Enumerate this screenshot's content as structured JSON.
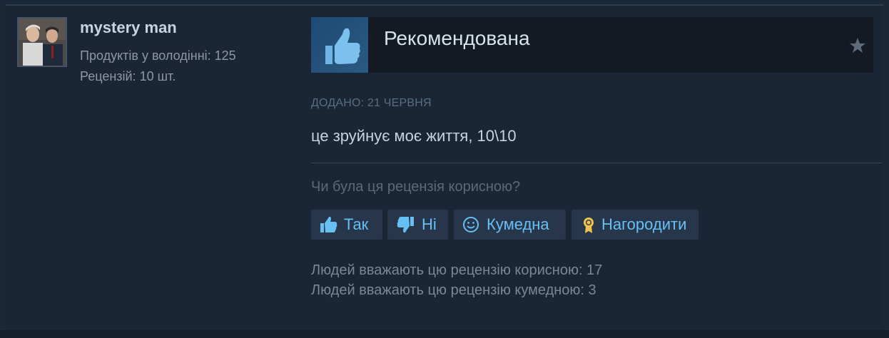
{
  "author": {
    "name": "mystery man",
    "products_owned": "Продуктів у володінні: 125",
    "reviews": "Рецензій: 10 шт."
  },
  "review": {
    "verdict": "Рекомендована",
    "posted": "ДОДАНО: 21 ЧЕРВНЯ",
    "text": "це зруйнує моє життя, 10\\10",
    "helpful_question": "Чи була ця рецензія корисною?"
  },
  "buttons": {
    "yes": "Так",
    "no": "Ні",
    "funny": "Кумедна",
    "award": "Нагородити"
  },
  "stats": {
    "helpful": "Людей вважають цю рецензію корисною: 17",
    "funny": "Людей вважають цю рецензію кумедною: 3"
  },
  "icons": {
    "verdict": "thumbs-up-icon",
    "favorite": "star-icon",
    "yes": "thumbs-up-icon",
    "no": "thumbs-down-icon",
    "funny": "smiley-icon",
    "award": "award-medal-icon"
  },
  "colors": {
    "background": "#1b2838",
    "accent": "#66c0f4",
    "button_bg": "#27364a",
    "award": "#f2c14e"
  }
}
